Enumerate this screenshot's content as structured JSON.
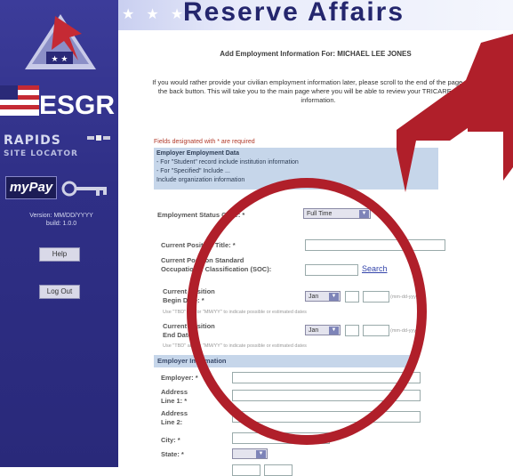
{
  "header": {
    "title": "Reserve Affairs",
    "stars": "★ ★ ★"
  },
  "sidebar": {
    "esgr_logo": "ESGR",
    "rapids_line1": "RAPIDS",
    "rapids_line2": "SITE LOCATOR",
    "mypay_label": "myPay",
    "version_line1": "Version: MM/DD/YYYY",
    "version_line2": "build: 1.0.0",
    "help_button": "Help",
    "logout_button": "Log Out"
  },
  "page": {
    "title": "Add Employment Information For: MICHAEL LEE JONES",
    "intro": "If you would rather provide your civilian employment information later, please scroll to the end of the page and hit the back button. This will take you to the main page where you will be able to review your TRICARE eligibility information.",
    "required_note": "Fields designated with * are required",
    "help_box": {
      "title": "Employer Employment Data",
      "line1": "- For \"Student\" record include institution information",
      "line2": "- For \"Specified\" Include ...",
      "line3": "Include organization information"
    }
  },
  "form": {
    "status_label": "Employment Status Code: *",
    "status_value": "Full Time",
    "position_title_label": "Current Position Title: *",
    "occ_label_1": "Current Position Standard",
    "occ_label_2": "Occupational Classification (SOC):",
    "search_link": "Search",
    "begin_label_1": "Current Position",
    "begin_label_2": "Begin Date: *",
    "begin_month": "Jan",
    "begin_hint": "Use \"TBD\" and/or \"MM/YY\" to indicate possible or estimated dates",
    "date_format": "(mm-dd-yyyy)",
    "end_label_1": "Current Position",
    "end_label_2": "End Date:",
    "end_month": "Jan",
    "end_hint": "Use \"TBD\" and/or \"MM/YY\" to indicate possible or estimated dates",
    "employer_section": "Employer Information",
    "employer_label": "Employer: *",
    "address1_label_1": "Address",
    "address1_label_2": "Line 1: *",
    "address2_label_1": "Address",
    "address2_label_2": "Line 2:",
    "city_label": "City: *",
    "state_label": "State: *"
  },
  "colors": {
    "sidebar": "#2f2f86",
    "banner_text": "#24266d",
    "overlay_red": "#b01f2a",
    "help_box": "#c6d6ea"
  }
}
